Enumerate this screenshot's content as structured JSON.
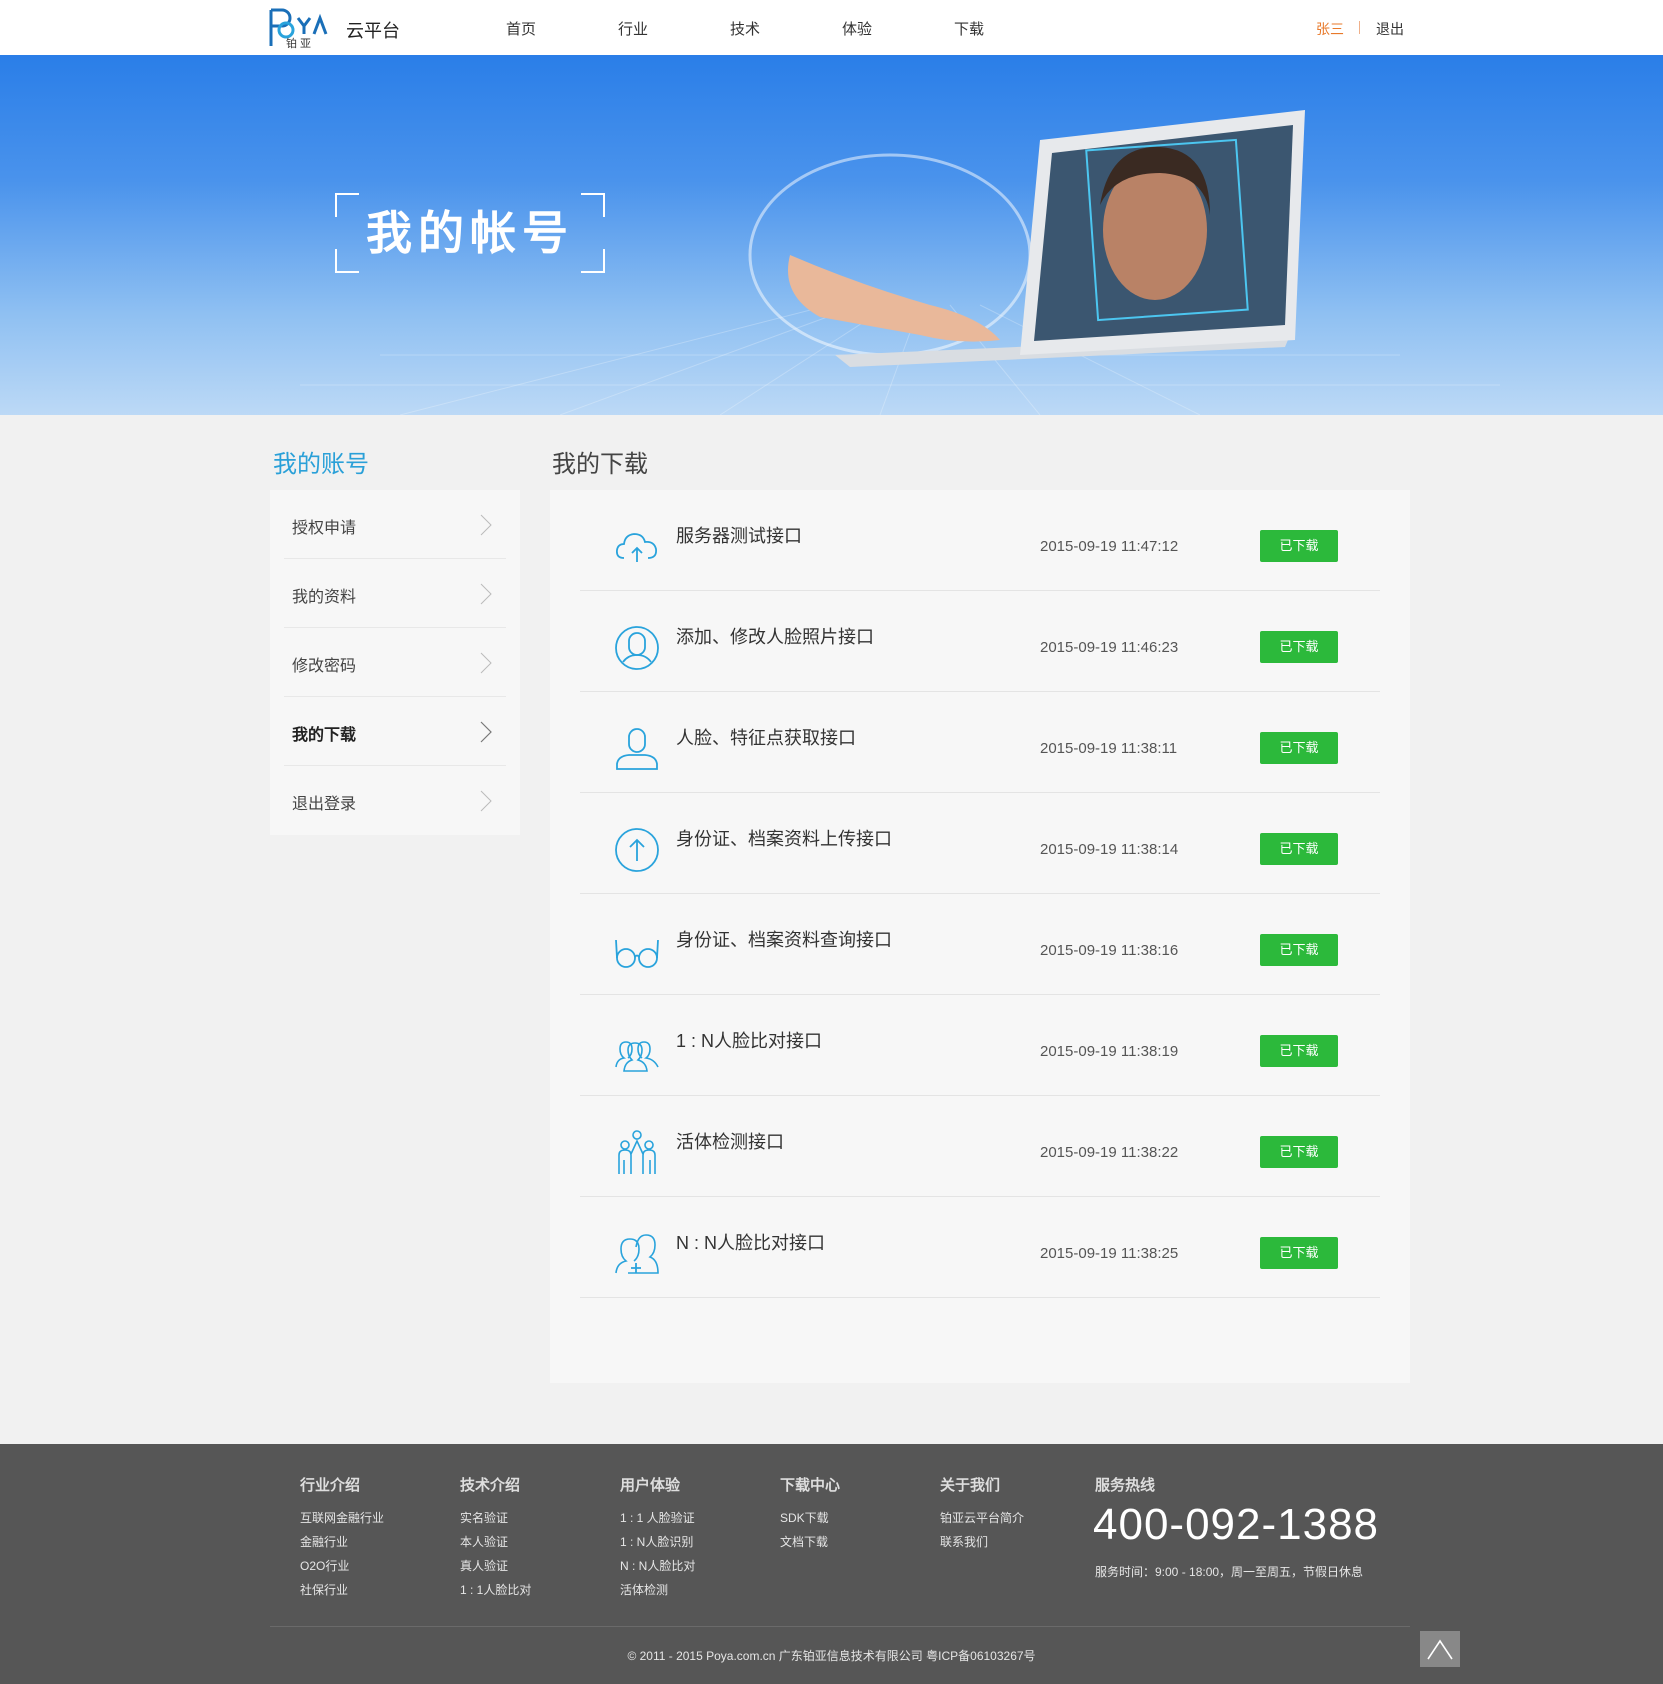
{
  "header": {
    "logo_text": "POYA",
    "logo_sub": "铂 亚",
    "brand": "云平台",
    "nav": [
      "首页",
      "行业",
      "技术",
      "体验",
      "下载"
    ],
    "user": "张三",
    "logout": "退出"
  },
  "banner": {
    "title": "我的帐号"
  },
  "sidebar": {
    "title": "我的账号",
    "items": [
      {
        "label": "授权申请"
      },
      {
        "label": "我的资料"
      },
      {
        "label": "修改密码"
      },
      {
        "label": "我的下载"
      },
      {
        "label": "退出登录"
      }
    ],
    "active_index": 3
  },
  "main": {
    "title": "我的下载",
    "downloads": [
      {
        "name": "服务器测试接口",
        "time": "2015-09-19 11:47:12",
        "status": "已下载",
        "icon": "cloud-upload-icon"
      },
      {
        "name": "添加、修改人脸照片接口",
        "time": "2015-09-19 11:46:23",
        "status": "已下载",
        "icon": "face-circle-icon"
      },
      {
        "name": "人脸、特征点获取接口",
        "time": "2015-09-19 11:38:11",
        "status": "已下载",
        "icon": "user-icon"
      },
      {
        "name": "身份证、档案资料上传接口",
        "time": "2015-09-19 11:38:14",
        "status": "已下载",
        "icon": "arrow-up-circle-icon"
      },
      {
        "name": "身份证、档案资料查询接口",
        "time": "2015-09-19 11:38:16",
        "status": "已下载",
        "icon": "glasses-icon"
      },
      {
        "name": "1 : N人脸比对接口",
        "time": "2015-09-19 11:38:19",
        "status": "已下载",
        "icon": "group-icon"
      },
      {
        "name": "活体检测接口",
        "time": "2015-09-19 11:38:22",
        "status": "已下载",
        "icon": "family-icon"
      },
      {
        "name": "N : N人脸比对接口",
        "time": "2015-09-19 11:38:25",
        "status": "已下载",
        "icon": "add-user-icon"
      }
    ]
  },
  "footer": {
    "columns": [
      {
        "title": "行业介绍",
        "links": [
          "互联网金融行业",
          "金融行业",
          "O2O行业",
          "社保行业"
        ]
      },
      {
        "title": "技术介绍",
        "links": [
          "实名验证",
          "本人验证",
          "真人验证",
          "1 : 1人脸比对"
        ]
      },
      {
        "title": "用户体验",
        "links": [
          "1 : 1 人脸验证",
          "1 : N人脸识别",
          "N : N人脸比对",
          "活体检测"
        ]
      },
      {
        "title": "下载中心",
        "links": [
          "SDK下载",
          "文档下载"
        ]
      },
      {
        "title": "关于我们",
        "links": [
          "铂亚云平台简介",
          "联系我们"
        ]
      }
    ],
    "hotline_title": "服务热线",
    "hotline": "400-092-1388",
    "hours": "服务时间：9:00 - 18:00，周一至周五，节假日休息",
    "copyright": "© 2011 - 2015 Poya.com.cn 广东铂亚信息技术有限公司 粤ICP备06103267号"
  },
  "colors": {
    "accent": "#2aa0d8",
    "button": "#2cb93b",
    "user": "#e8792a",
    "footer_bg": "#565656",
    "icon_stroke": "#29a3dc"
  }
}
